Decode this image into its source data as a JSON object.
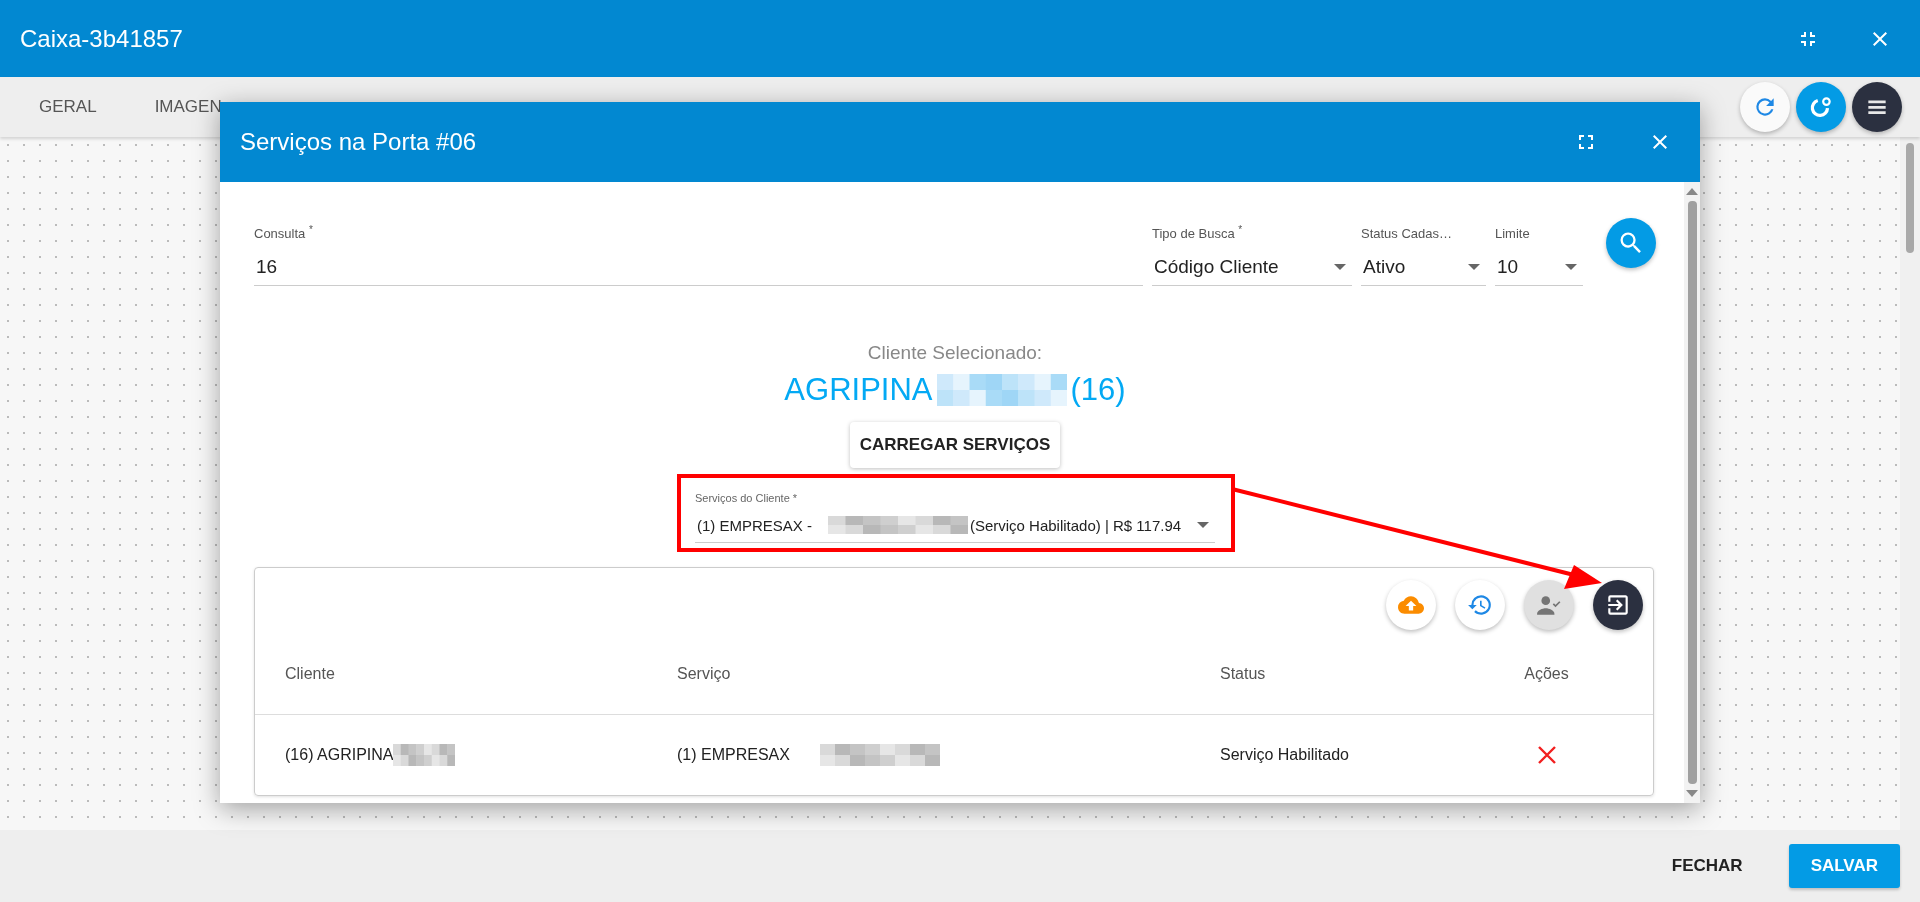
{
  "window": {
    "title": "Caixa-3b41857"
  },
  "tabs": [
    {
      "label": "GERAL",
      "selected": false
    },
    {
      "label": "IMAGEN",
      "selected": false
    }
  ],
  "dialog": {
    "title": "Serviços na Porta #06",
    "fields": [
      {
        "kind": "text",
        "label": "Consulta $^{*}$",
        "value": "16"
      },
      {
        "kind": "select",
        "label": "Tipo de Busca $^{*}$",
        "value": "Código Cliente"
      },
      {
        "kind": "select",
        "label": "Status Cadas…",
        "value": "Ativo"
      },
      {
        "kind": "select",
        "label": "Limite",
        "value": "10"
      }
    ],
    "selected_client": {
      "label": "Cliente Selecionado:",
      "name": "AGRIPINA",
      "code": "(16)"
    },
    "load_button": "CARREGAR SERVIÇOS",
    "services_select": {
      "label": "Serviços do Cliente *",
      "value_start": "(1) EMPRESAX -",
      "value_end": "(Serviço Habilitado) | R$ 117.94"
    },
    "table": {
      "columns": [
        "Cliente",
        "Serviço",
        "Status",
        "Ações"
      ],
      "rows": [
        {
          "cliente": "(16) AGRIPINA",
          "servico": "(1) EMPRESAX",
          "status": "Serviço Habilitado"
        }
      ]
    }
  },
  "footer": {
    "buttons": [
      {
        "label": "FECHAR",
        "kind": "text"
      },
      {
        "label": "SALVAR",
        "kind": "primary"
      }
    ]
  }
}
